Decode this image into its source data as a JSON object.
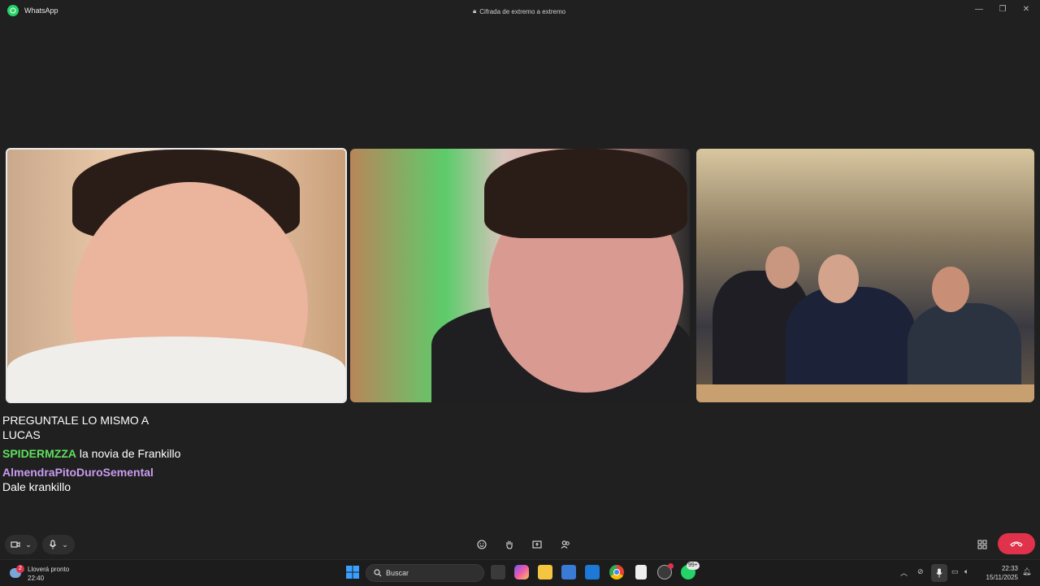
{
  "titlebar": {
    "app_name": "WhatsApp",
    "encryption_label": "Cifrada de extremo a extremo"
  },
  "chat": {
    "messages": [
      {
        "user": "",
        "text": "PREGUNTALE LO MISMO A LUCAS",
        "user_color": ""
      },
      {
        "user": "SPIDERMZZA",
        "text": "la novia de Frankillo",
        "user_color": "#5ee05e"
      },
      {
        "user": "AlmendraPitoDuroSemental",
        "text": "Dale krankillo",
        "user_color": "#c89cf0"
      }
    ]
  },
  "colors": {
    "end_call": "#e0324a",
    "whatsapp_green": "#25d366",
    "background": "#202020"
  },
  "callbar": {
    "icons": [
      "camera-icon",
      "mic-icon",
      "emoji-icon",
      "raise-hand-icon",
      "share-screen-icon",
      "add-participant-icon",
      "layout-icon",
      "end-call-icon"
    ]
  },
  "taskbar": {
    "weather_badge": "2",
    "weather_text": "Lloverá pronto",
    "weather_time": "22:40",
    "search_placeholder": "Buscar",
    "whatsapp_badge": "99+",
    "clock_time": "22:33",
    "clock_date": "15/11/2025"
  }
}
